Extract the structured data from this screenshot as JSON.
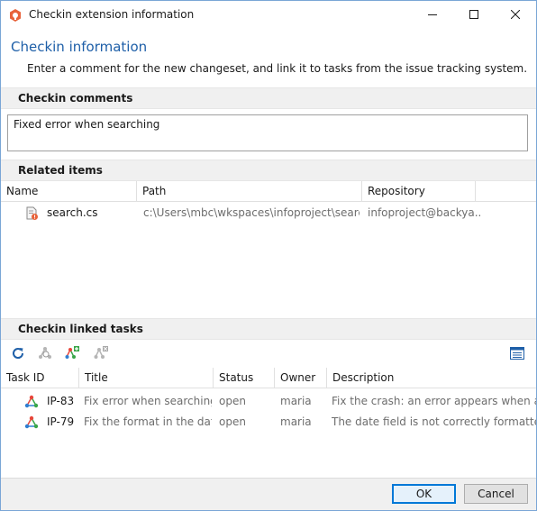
{
  "window": {
    "title": "Checkin extension information"
  },
  "header": {
    "title": "Checkin information",
    "subtitle": "Enter a comment for the new changeset, and link it to tasks from the issue tracking system."
  },
  "comments": {
    "label": "Checkin comments",
    "value": "Fixed error when searching"
  },
  "related": {
    "label": "Related items",
    "columns": [
      "Name",
      "Path",
      "Repository"
    ],
    "rows": [
      {
        "name": "search.cs",
        "path": "c:\\Users\\mbc\\wkspaces\\infoproject\\search",
        "repository": "infoproject@backya..."
      }
    ]
  },
  "tasks": {
    "label": "Checkin linked tasks",
    "columns": [
      "Task ID",
      "Title",
      "Status",
      "Owner",
      "Description"
    ],
    "rows": [
      {
        "id": "IP-83",
        "title": "Fix error when searching ...",
        "status": "open",
        "owner": "maria",
        "description": "Fix the crash: an error appears when a user t"
      },
      {
        "id": "IP-79",
        "title": "Fix the format in the date...",
        "status": "open",
        "owner": "maria",
        "description": "The date field is not correctly formatted. It"
      }
    ]
  },
  "toolbar": {
    "icons": [
      "refresh-icon",
      "find-task-icon",
      "add-task-icon",
      "remove-task-icon",
      "columns-icon"
    ]
  },
  "buttons": {
    "ok": "OK",
    "cancel": "Cancel"
  },
  "colors": {
    "accent": "#1e5fa8",
    "task_icon_red": "#e8463a",
    "task_icon_green": "#3aa64a",
    "task_icon_blue": "#2f7fd1"
  }
}
